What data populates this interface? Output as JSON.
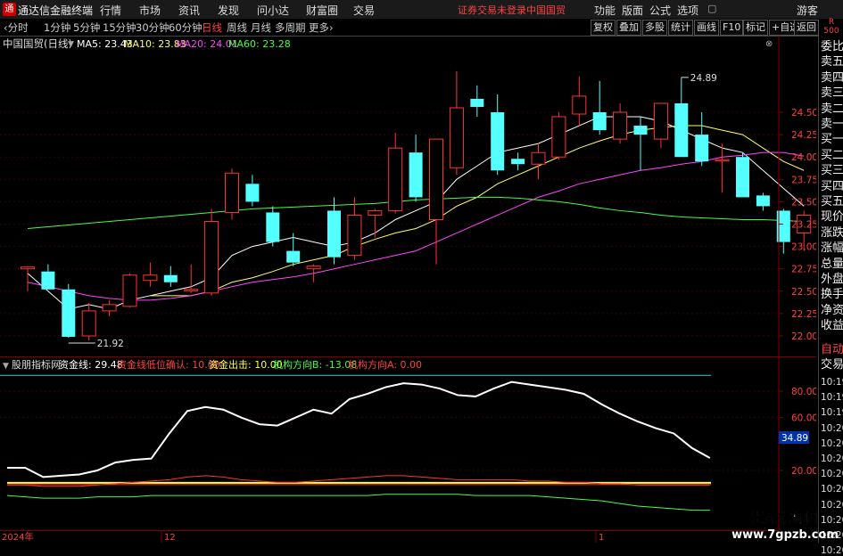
{
  "titlebar": {
    "app_name": "通达信金融终端",
    "menus": [
      "行情",
      "市场",
      "资讯",
      "发现",
      "问小达",
      "财富圈",
      "交易"
    ],
    "status": "证券交易未登录",
    "stock": "中国国贸",
    "right_menus": [
      "功能",
      "版面",
      "公式",
      "选项"
    ],
    "guest": "游客"
  },
  "period_bar": {
    "periods": [
      "分时",
      "1分钟",
      "5分钟",
      "15分钟",
      "30分钟",
      "60分钟",
      "日线",
      "周线",
      "月线",
      "多周期",
      "更多"
    ],
    "active_period": "日线",
    "buttons": [
      "复权",
      "叠加",
      "多股",
      "统计",
      "画线",
      "F10",
      "标记",
      "+自选",
      "返回"
    ],
    "corner_top": "R",
    "corner_bottom": "500"
  },
  "main_chart": {
    "title": "中国国贸(日线)",
    "ma": [
      {
        "label": "MA5: 23.43",
        "color": "#ffffff"
      },
      {
        "label": "MA10: 23.83",
        "color": "#ffff66"
      },
      {
        "label": "MA20: 24.01",
        "color": "#ff44ff"
      },
      {
        "label": "MA60: 23.28",
        "color": "#44ff44"
      }
    ],
    "price_labels": [
      "24.50",
      "24.25",
      "24.00",
      "23.75",
      "23.50",
      "23.25",
      "23.00",
      "22.75",
      "22.50",
      "22.25",
      "22.00"
    ],
    "high_marker": "24.89",
    "low_marker": "21.92"
  },
  "sub_chart": {
    "name": "股朋指标网",
    "legend": [
      {
        "label": "资金线: 29.48",
        "color": "#ffffff"
      },
      {
        "label": "资金线低位确认: 10.00",
        "color": "#ff4040"
      },
      {
        "label": "资金出击: 10.00",
        "color": "#ffff44"
      },
      {
        "label": "机构方向B: -13.08",
        "color": "#44ff44"
      },
      {
        "label": "机构方向A: 0.00",
        "color": "#ff4040"
      }
    ],
    "y_labels": [
      "80.00",
      "60.00",
      "20.00"
    ],
    "value_tag": "34.89"
  },
  "x_axis": {
    "labels": [
      "2024年",
      "12",
      "1"
    ]
  },
  "right_panel": {
    "items": [
      "委比",
      "卖五",
      "卖四",
      "卖三",
      "卖二",
      "卖一",
      "买一",
      "买二",
      "买三",
      "买四",
      "买五",
      "现价",
      "涨跌",
      "涨幅",
      "总量",
      "外盘",
      "换手",
      "净资",
      "收益"
    ],
    "auto": "自动",
    "trade": "交易",
    "times": [
      "10:19",
      "10:19",
      "10:19",
      "10:20",
      "10:20",
      "10:20",
      "10:20",
      "10:20",
      "10:20",
      "10:20",
      "10:20",
      "10:20"
    ]
  },
  "watermark": {
    "line1": "股朋指标网",
    "line2": "www.7gpzb.com"
  },
  "chart_data": {
    "type": "candlestick",
    "title": "中国国贸(日线)",
    "ylim": [
      21.8,
      25.2
    ],
    "candles": [
      {
        "o": 22.75,
        "h": 22.78,
        "l": 22.5,
        "c": 22.77
      },
      {
        "o": 22.72,
        "h": 22.8,
        "l": 22.55,
        "c": 22.52
      },
      {
        "o": 22.52,
        "h": 22.58,
        "l": 21.98,
        "c": 21.99
      },
      {
        "o": 22.0,
        "h": 22.37,
        "l": 21.95,
        "c": 22.28
      },
      {
        "o": 22.28,
        "h": 22.4,
        "l": 22.22,
        "c": 22.35
      },
      {
        "o": 22.33,
        "h": 22.7,
        "l": 22.32,
        "c": 22.68
      },
      {
        "o": 22.62,
        "h": 22.82,
        "l": 22.55,
        "c": 22.68
      },
      {
        "o": 22.68,
        "h": 22.78,
        "l": 22.55,
        "c": 22.6
      },
      {
        "o": 22.52,
        "h": 22.8,
        "l": 22.48,
        "c": 22.52
      },
      {
        "o": 22.48,
        "h": 23.42,
        "l": 22.45,
        "c": 23.28
      },
      {
        "o": 23.38,
        "h": 23.87,
        "l": 23.3,
        "c": 23.82
      },
      {
        "o": 23.7,
        "h": 23.8,
        "l": 23.45,
        "c": 23.5
      },
      {
        "o": 23.38,
        "h": 23.45,
        "l": 23.0,
        "c": 23.05
      },
      {
        "o": 22.95,
        "h": 23.15,
        "l": 22.78,
        "c": 22.82
      },
      {
        "o": 22.75,
        "h": 22.8,
        "l": 22.6,
        "c": 22.78
      },
      {
        "o": 23.4,
        "h": 23.55,
        "l": 22.8,
        "c": 22.88
      },
      {
        "o": 22.9,
        "h": 23.55,
        "l": 22.85,
        "c": 23.35
      },
      {
        "o": 23.35,
        "h": 23.42,
        "l": 23.1,
        "c": 23.4
      },
      {
        "o": 23.4,
        "h": 24.27,
        "l": 23.37,
        "c": 24.1
      },
      {
        "o": 24.05,
        "h": 24.25,
        "l": 23.5,
        "c": 23.55
      },
      {
        "o": 23.3,
        "h": 24.2,
        "l": 22.8,
        "c": 24.2
      },
      {
        "o": 23.88,
        "h": 24.96,
        "l": 23.8,
        "c": 24.55
      },
      {
        "o": 24.65,
        "h": 24.8,
        "l": 24.45,
        "c": 24.56
      },
      {
        "o": 24.5,
        "h": 24.7,
        "l": 23.8,
        "c": 23.85
      },
      {
        "o": 23.98,
        "h": 24.05,
        "l": 23.85,
        "c": 23.92
      },
      {
        "o": 23.92,
        "h": 24.15,
        "l": 23.75,
        "c": 24.05
      },
      {
        "o": 24.0,
        "h": 24.5,
        "l": 23.97,
        "c": 24.45
      },
      {
        "o": 24.48,
        "h": 24.9,
        "l": 24.35,
        "c": 24.68
      },
      {
        "o": 24.5,
        "h": 24.85,
        "l": 24.25,
        "c": 24.3
      },
      {
        "o": 24.2,
        "h": 24.6,
        "l": 24.15,
        "c": 24.5
      },
      {
        "o": 24.35,
        "h": 24.45,
        "l": 23.85,
        "c": 24.25
      },
      {
        "o": 24.2,
        "h": 24.6,
        "l": 24.1,
        "c": 24.6
      },
      {
        "o": 24.6,
        "h": 24.89,
        "l": 24.0,
        "c": 24.0
      },
      {
        "o": 24.25,
        "h": 24.5,
        "l": 23.9,
        "c": 23.95
      },
      {
        "o": 23.97,
        "h": 24.15,
        "l": 23.6,
        "c": 23.97
      },
      {
        "o": 24.0,
        "h": 24.05,
        "l": 23.55,
        "c": 23.55
      },
      {
        "o": 23.57,
        "h": 23.6,
        "l": 23.4,
        "c": 23.45
      },
      {
        "o": 23.4,
        "h": 23.42,
        "l": 22.92,
        "c": 23.05
      },
      {
        "o": 23.15,
        "h": 23.4,
        "l": 22.95,
        "c": 23.35
      }
    ],
    "ma": {
      "MA5": [
        22.7,
        22.5,
        22.3,
        22.35,
        22.3,
        22.4,
        22.45,
        22.5,
        22.55,
        22.65,
        22.9,
        23.0,
        23.05,
        23.1,
        23.05,
        23.0,
        23.05,
        23.15,
        23.3,
        23.4,
        23.5,
        23.75,
        23.9,
        24.05,
        24.1,
        24.15,
        24.25,
        24.35,
        24.45,
        24.45,
        24.45,
        24.4,
        24.3,
        24.2,
        24.1,
        24.05,
        23.85,
        23.65,
        23.45
      ],
      "MA10": [
        null,
        null,
        null,
        null,
        null,
        null,
        22.45,
        22.45,
        22.45,
        22.5,
        22.6,
        22.65,
        22.72,
        22.8,
        22.85,
        22.9,
        23.0,
        23.08,
        23.15,
        23.2,
        23.3,
        23.45,
        23.55,
        23.7,
        23.8,
        23.9,
        24.0,
        24.1,
        24.18,
        24.25,
        24.3,
        24.33,
        24.35,
        24.35,
        24.3,
        24.25,
        24.1,
        23.95,
        23.85
      ],
      "MA20": [
        22.6,
        22.55,
        22.5,
        22.45,
        22.42,
        22.4,
        22.4,
        22.42,
        22.45,
        22.5,
        22.55,
        22.6,
        22.63,
        22.66,
        22.7,
        22.75,
        22.8,
        22.85,
        22.9,
        22.95,
        23.05,
        23.15,
        23.25,
        23.35,
        23.45,
        23.55,
        23.62,
        23.7,
        23.75,
        23.8,
        23.85,
        23.88,
        23.92,
        23.95,
        24.0,
        24.02,
        24.05,
        24.05,
        24.01
      ],
      "MA60": [
        23.2,
        23.22,
        23.24,
        23.26,
        23.28,
        23.3,
        23.32,
        23.34,
        23.36,
        23.38,
        23.4,
        23.42,
        23.43,
        23.44,
        23.45,
        23.46,
        23.47,
        23.48,
        23.5,
        23.52,
        23.53,
        23.54,
        23.55,
        23.55,
        23.54,
        23.52,
        23.5,
        23.47,
        23.43,
        23.4,
        23.38,
        23.35,
        23.33,
        23.32,
        23.31,
        23.3,
        23.3,
        23.29,
        23.28
      ]
    },
    "indicator": {
      "ylim": [
        0,
        92
      ],
      "fund_line": [
        22,
        22,
        15,
        16,
        17,
        20,
        26,
        28,
        29,
        48,
        65,
        68,
        66,
        60,
        55,
        54,
        60,
        66,
        63,
        74,
        78,
        83,
        86,
        85,
        82,
        77,
        76,
        82,
        87,
        85,
        83,
        81,
        78,
        70,
        63,
        57,
        52,
        48,
        37,
        29.48
      ],
      "confirm_low": 10,
      "attack": 10,
      "inst_a": [
        0,
        0,
        0,
        0,
        0,
        0,
        0,
        0,
        0,
        0,
        0,
        0,
        0,
        0,
        0,
        0,
        0,
        0,
        0,
        0,
        0,
        0,
        0,
        0,
        0,
        0,
        0,
        0,
        0,
        0,
        0,
        0,
        0,
        0,
        0,
        0,
        0,
        0,
        0,
        0
      ],
      "inst_b": [
        -2,
        -3,
        -4,
        -4,
        -4,
        -3,
        -3,
        -3,
        -2,
        -2,
        -2,
        -2,
        -2,
        -2,
        -2,
        -2,
        -2,
        -2,
        -2,
        -2,
        -2,
        -1,
        -1,
        -1,
        -1,
        -1,
        -2,
        -2,
        -2,
        -2,
        -3,
        -4,
        -5,
        -6,
        -8,
        -10,
        -11,
        -12,
        -13,
        -13.08
      ],
      "red_line": [
        9,
        9,
        8,
        8,
        8,
        9,
        10,
        11,
        12,
        13,
        15,
        16,
        15,
        13,
        12,
        11,
        11,
        12,
        13,
        14,
        15,
        16,
        16,
        15,
        14,
        13,
        13,
        13,
        13,
        12,
        12,
        11,
        11,
        10,
        10,
        9,
        9,
        9,
        9,
        9
      ]
    }
  }
}
